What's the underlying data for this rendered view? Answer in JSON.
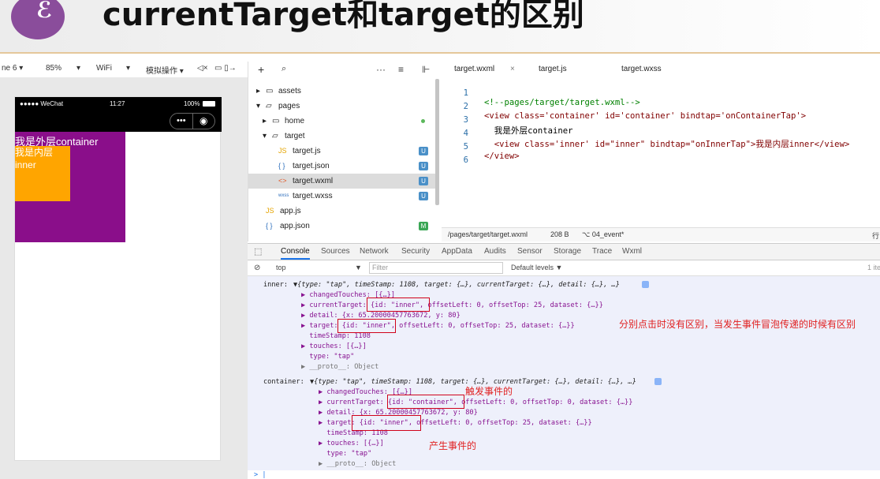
{
  "slide": {
    "title": "currentTarget和target的区别",
    "logo_glyph": "ℰ"
  },
  "simulator_toolbar": {
    "device": "ne 6 ▾",
    "zoom": "85%",
    "network": "WiFi",
    "operation": "模拟操作 ▾",
    "sound_icon": "◁×",
    "more_icons": "▭ ▯→"
  },
  "phone": {
    "carrier": "●●●●● WeChat",
    "time": "11:27",
    "battery": "100%",
    "capsule_more": "•••",
    "capsule_close": "◉",
    "outer_text": "我是外层container",
    "inner_text_1": "我是内层",
    "inner_text_2": "inner"
  },
  "tree_toolbar": {
    "add": "+",
    "search": "🔍",
    "more": "···",
    "sort": "≡",
    "collapse": "⊩"
  },
  "file_tree": [
    {
      "label": "assets",
      "type": "folder",
      "arrow": "▸"
    },
    {
      "label": "pages",
      "type": "folder-open",
      "arrow": "▾"
    },
    {
      "label": "home",
      "type": "folder",
      "arrow": "▸"
    },
    {
      "label": "target",
      "type": "folder-open",
      "arrow": "▾"
    },
    {
      "label": "target.js",
      "type": "js",
      "badge": "U"
    },
    {
      "label": "target.json",
      "type": "json",
      "badge": "U"
    },
    {
      "label": "target.wxml",
      "type": "wxml",
      "badge": "U"
    },
    {
      "label": "target.wxss",
      "type": "wxss",
      "badge": "U"
    },
    {
      "label": "app.js",
      "type": "js"
    },
    {
      "label": "app.json",
      "type": "json",
      "badge": "M"
    }
  ],
  "editor": {
    "tabs": [
      "target.wxml",
      "target.js",
      "target.wxss"
    ],
    "close_glyph": "×",
    "lines": [
      {
        "no": "1",
        "text": "<!--pages/target/target.wxml-->"
      },
      {
        "no": "2",
        "text": "<view class='container' id='container' bindtap='onContainerTap'>"
      },
      {
        "no": "3",
        "text": "  我是外层container"
      },
      {
        "no": "4",
        "text": "  <view class='inner' id=\"inner\" bindtap=\"onInnerTap\">我是内层inner</view>"
      },
      {
        "no": "5",
        "text": "</view>"
      },
      {
        "no": "6",
        "text": ""
      }
    ],
    "status_path": "/pages/target/target.wxml",
    "status_size": "208 B",
    "status_branch": "⌥ 04_event*",
    "status_right": "行"
  },
  "devtools": {
    "tabs": [
      "Console",
      "Sources",
      "Network",
      "Security",
      "AppData",
      "Audits",
      "Sensor",
      "Storage",
      "Trace",
      "Wxml"
    ],
    "context": "top",
    "filter_placeholder": "Filter",
    "levels": "Default levels ▼",
    "right_count": "1 ite"
  },
  "console_inner": {
    "label": "inner:",
    "summary": "▼{type: \"tap\", timeStamp: 1108, target: {…}, currentTarget: {…}, detail: {…}, …}",
    "lines": [
      "▶ changedTouches: [{…}]",
      "▶ currentTarget: {id: \"inner\", offsetLeft: 0, offsetTop: 25, dataset: {…}}",
      "▶ detail: {x: 65.20000457763672, y: 80}",
      "▶ target: {id: \"inner\", offsetLeft: 0, offsetTop: 25, dataset: {…}}",
      "  timeStamp: 1108",
      "▶ touches: [{…}]",
      "  type: \"tap\"",
      "▶ __proto__: Object"
    ]
  },
  "console_container": {
    "label": "container:",
    "summary": "▼{type: \"tap\", timeStamp: 1108, target: {…}, currentTarget: {…}, detail: {…}, …}",
    "lines": [
      "▶ changedTouches: [{…}]",
      "▶ currentTarget: {id: \"container\", offsetLeft: 0, offsetTop: 0, dataset: {…}}",
      "▶ detail: {x: 65.20000457763672, y: 80}",
      "▶ target: {id: \"inner\", offsetLeft: 0, offsetTop: 25, dataset: {…}}",
      "  timeStamp: 1108",
      "▶ touches: [{…}]",
      "  type: \"tap\"",
      "▶ __proto__: Object"
    ]
  },
  "prompt": "> |",
  "annotations": {
    "difference": "分别点击时没有区别，当发生事件冒泡传递的时候有区别",
    "trigger": "触发事件的",
    "produce": "产生事件的"
  },
  "colors": {
    "outer": "#8a0e8a",
    "inner": "#ffa500",
    "accent": "#d0021b",
    "logo": "#8a4d9b"
  }
}
